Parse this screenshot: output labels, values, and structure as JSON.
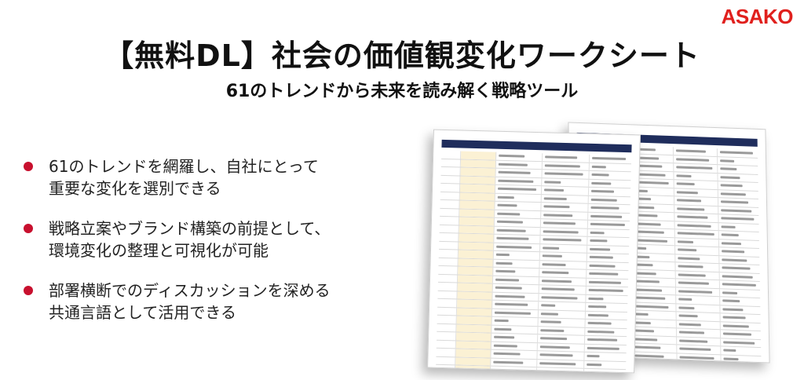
{
  "brand": {
    "logo_text": "ASAKO",
    "color": "#e0201d"
  },
  "header": {
    "title": "【無料DL】社会の価値観変化ワークシート",
    "subtitle": "61のトレンドから未来を読み解く戦略ツール"
  },
  "bullets": [
    {
      "line1": "61のトレンドを網羅し、自社にとって",
      "line2": "重要な変化を選別できる"
    },
    {
      "line1": "戦略立案やブランド構築の前提として、",
      "line2": "環境変化の整理と可視化が可能"
    },
    {
      "line1": "部署横断でのディスカッションを深める",
      "line2": "共通言語として活用できる"
    }
  ],
  "accent_color": "#c8102e"
}
